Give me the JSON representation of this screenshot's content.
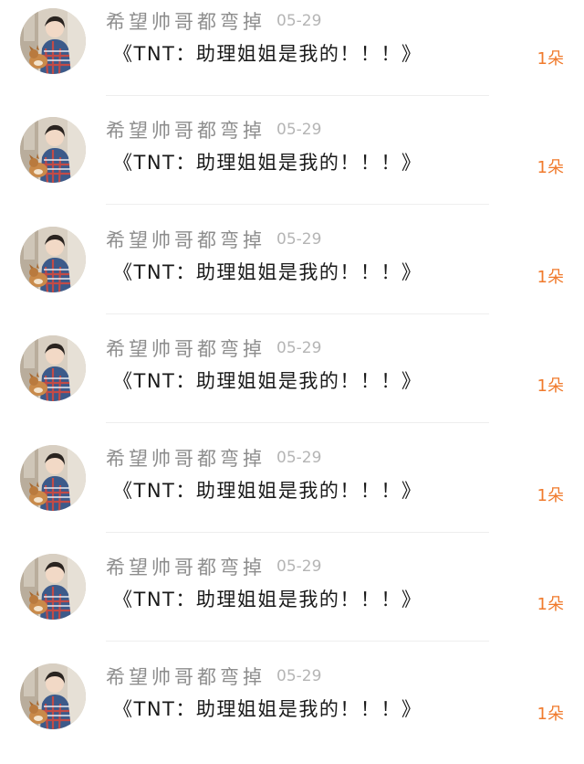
{
  "gift_list": {
    "items": [
      {
        "username": "希望帅哥都弯掉",
        "date": "05-29",
        "message": "《TNT：助理姐姐是我的！！！》",
        "count": "1朵"
      },
      {
        "username": "希望帅哥都弯掉",
        "date": "05-29",
        "message": "《TNT：助理姐姐是我的！！！》",
        "count": "1朵"
      },
      {
        "username": "希望帅哥都弯掉",
        "date": "05-29",
        "message": "《TNT：助理姐姐是我的！！！》",
        "count": "1朵"
      },
      {
        "username": "希望帅哥都弯掉",
        "date": "05-29",
        "message": "《TNT：助理姐姐是我的！！！》",
        "count": "1朵"
      },
      {
        "username": "希望帅哥都弯掉",
        "date": "05-29",
        "message": "《TNT：助理姐姐是我的！！！》",
        "count": "1朵"
      },
      {
        "username": "希望帅哥都弯掉",
        "date": "05-29",
        "message": "《TNT：助理姐姐是我的！！！》",
        "count": "1朵"
      },
      {
        "username": "希望帅哥都弯掉",
        "date": "05-29",
        "message": "《TNT：助理姐姐是我的！！！》",
        "count": "1朵"
      }
    ]
  },
  "colors": {
    "username": "#8d8d8d",
    "date": "#b5b5b5",
    "message": "#1a1a1a",
    "count_accent": "#f07a2c",
    "divider": "#eeeeee"
  },
  "icons": {
    "avatar": "user-photo-avatar"
  }
}
